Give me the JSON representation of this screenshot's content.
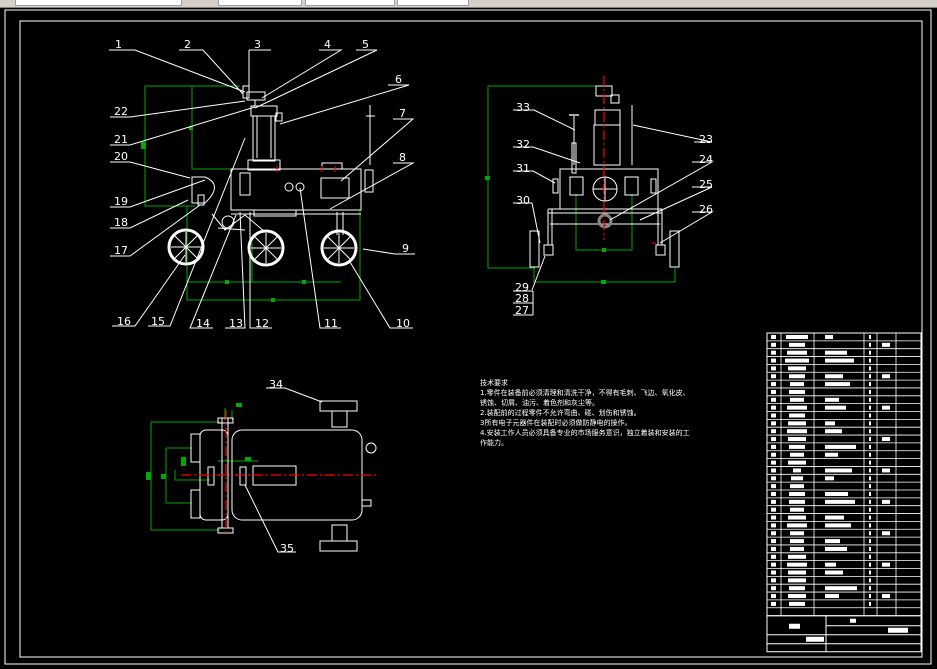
{
  "drawing": {
    "view_front_labels": [
      "1",
      "2",
      "3",
      "4",
      "5",
      "6",
      "7",
      "8",
      "9",
      "10",
      "11",
      "12",
      "13",
      "14",
      "15",
      "16",
      "17",
      "18",
      "19",
      "20",
      "21",
      "22"
    ],
    "view_side_labels": [
      "23",
      "24",
      "25",
      "26",
      "27",
      "28",
      "29",
      "30",
      "31",
      "32",
      "33"
    ],
    "view_top_labels": [
      "34",
      "35"
    ]
  },
  "technical_requirements": {
    "title": "技术要求",
    "items": [
      "1.零件在装备前必须清理和清洗干净，不得有毛刺、飞边、氧化皮、",
      "锈蚀、切屑、油污、着色剂和灰尘等。",
      "2.装配前的过程零件不允许弯曲、碰、划伤和锈蚀。",
      "3所有电子元器件在装配时必须做防静电的操作。",
      "4.安装工作人员必须具备专业的市场服务意识，独立着装和安装的工",
      "作能力。"
    ]
  },
  "colors": {
    "background": "#000000",
    "lines": "#ffffff",
    "dimensions": "#00aa00",
    "centerlines": "#ff0000"
  }
}
